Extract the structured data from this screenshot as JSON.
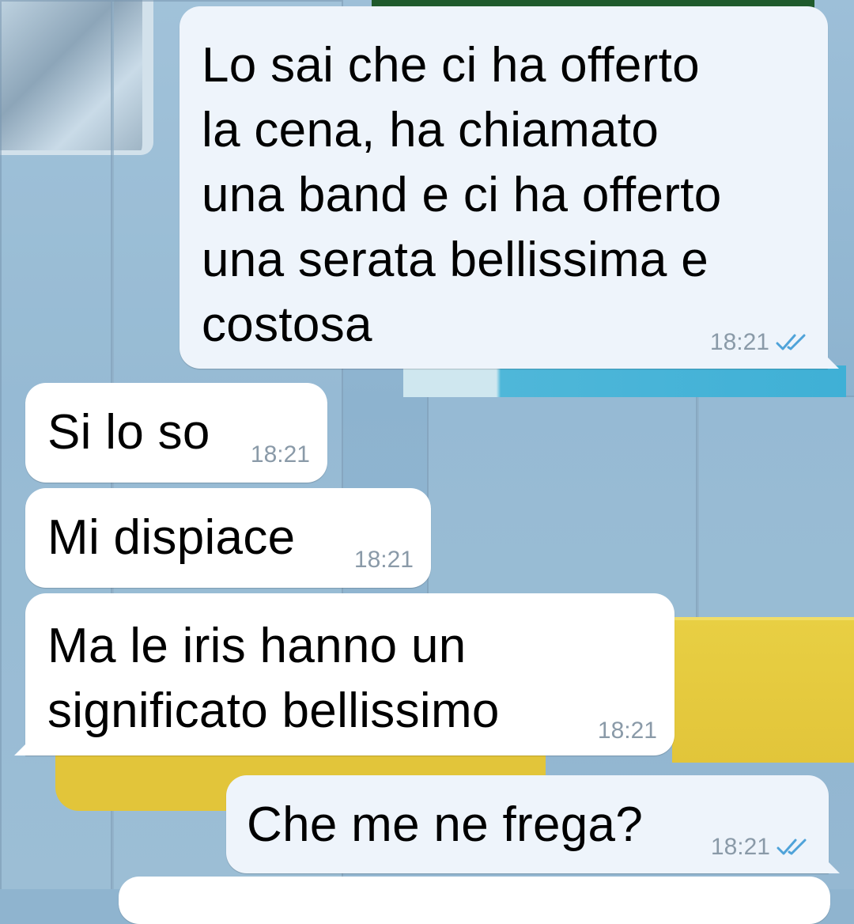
{
  "messages": [
    {
      "direction": "outgoing",
      "text": "Lo sai che ci ha offerto\nla cena, ha chiamato\nuna band e ci ha offerto\nuna serata bellissima e\ncostosa",
      "time": "18:21",
      "status_icon": "double-check-read-icon"
    },
    {
      "direction": "incoming",
      "text": "Si lo so",
      "time": "18:21"
    },
    {
      "direction": "incoming",
      "text": "Mi dispiace",
      "time": "18:21"
    },
    {
      "direction": "incoming",
      "text": "Ma le iris hanno un\nsignificato bellissimo",
      "time": "18:21"
    },
    {
      "direction": "outgoing",
      "text": "Che me ne frega?",
      "time": "18:21",
      "status_icon": "double-check-read-icon"
    }
  ],
  "colors": {
    "outgoing_bubble": "#eef4fb",
    "incoming_bubble": "#ffffff",
    "read_ticks": "#4fa3d9",
    "timestamp": "#8a9aa8"
  }
}
